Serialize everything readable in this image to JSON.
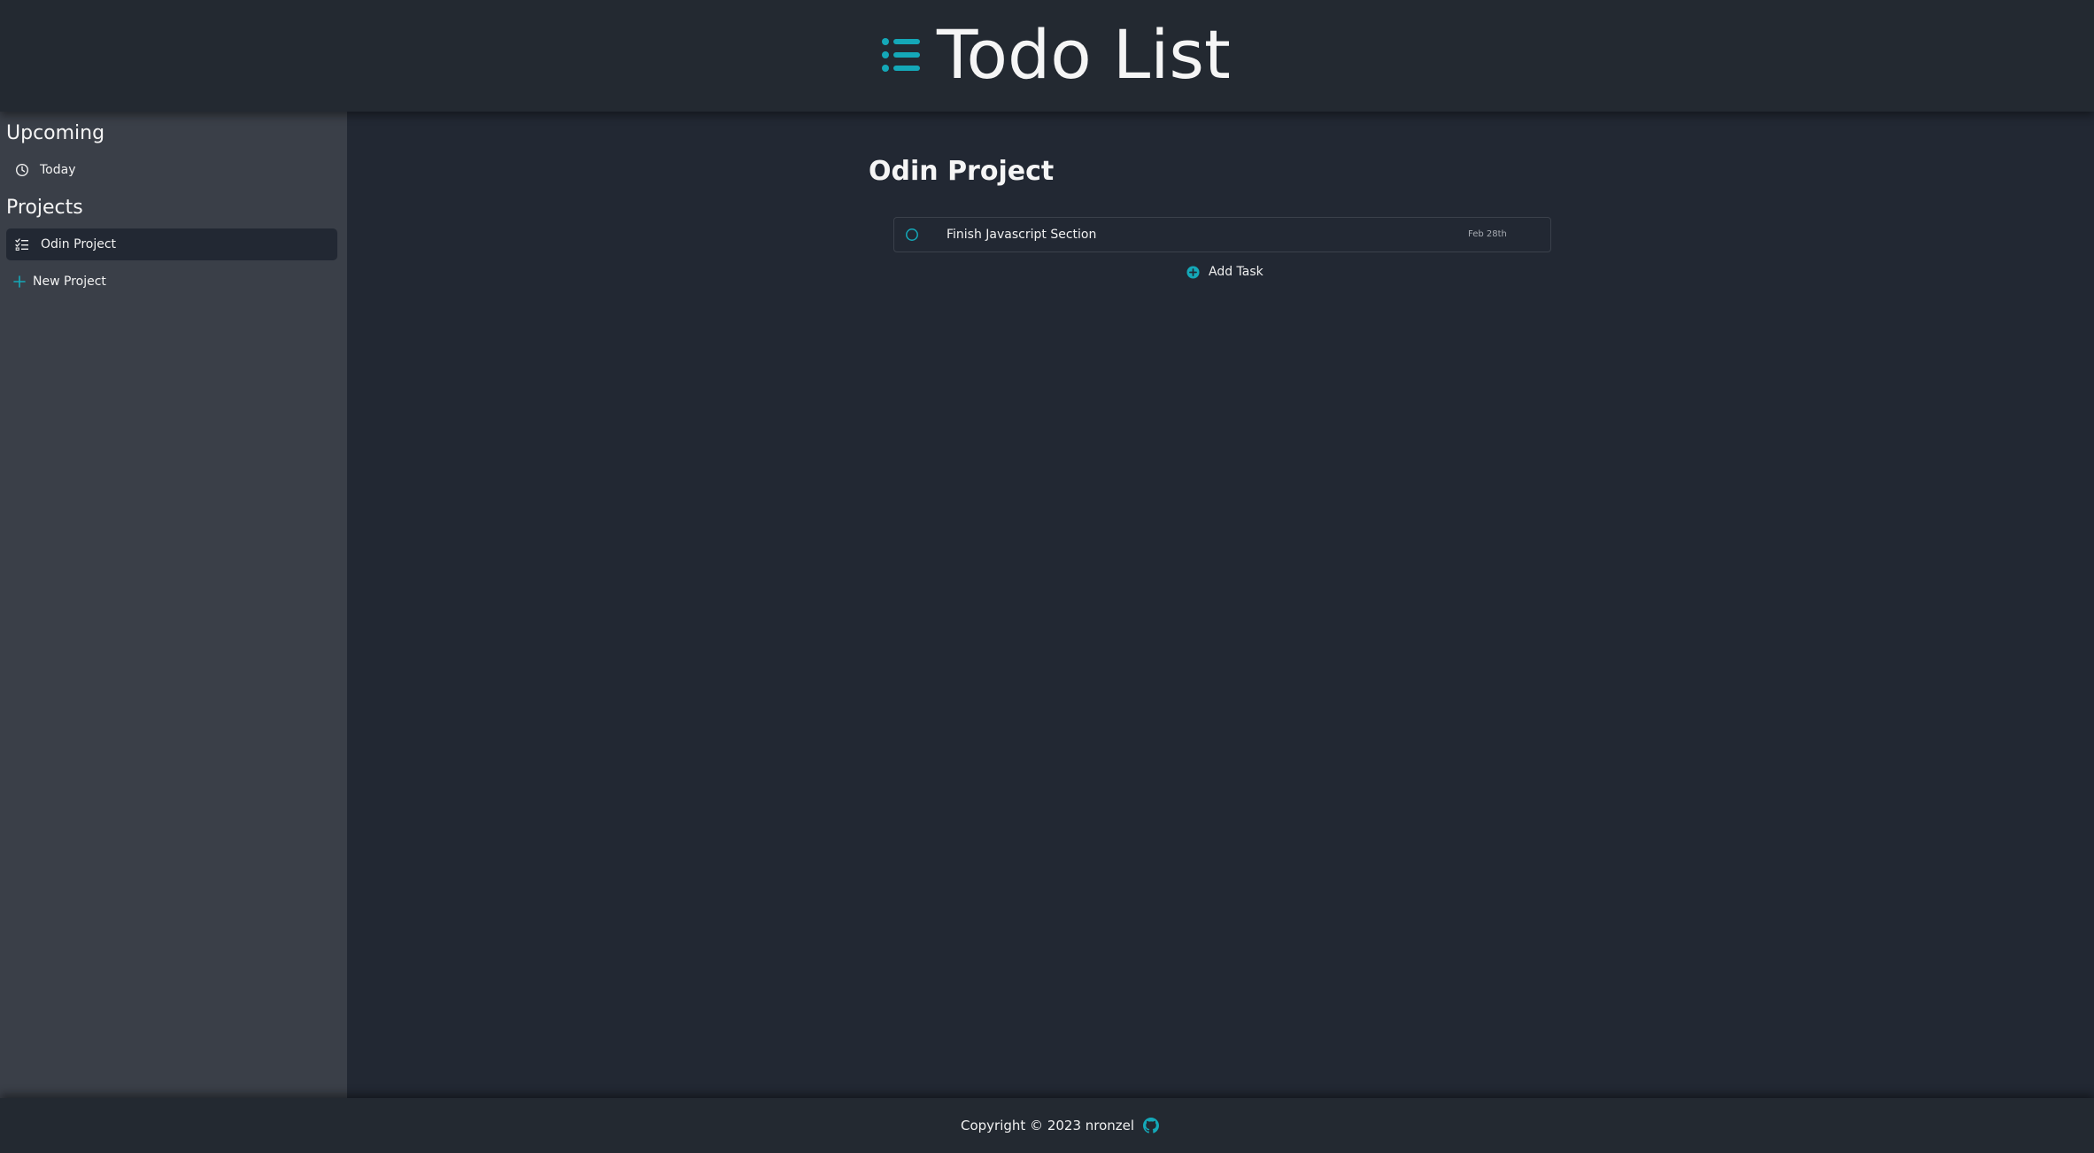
{
  "colors": {
    "accent": "#14a8b8",
    "background": "#222833",
    "header": "#232931",
    "sidebar": "#3a3f48"
  },
  "header": {
    "title": "Todo List",
    "logo_icon": "list-icon"
  },
  "sidebar": {
    "upcoming_heading": "Upcoming",
    "upcoming_items": [
      {
        "label": "Today",
        "icon": "clock-icon"
      }
    ],
    "projects_heading": "Projects",
    "projects": [
      {
        "label": "Odin Project",
        "icon": "checklist-icon",
        "active": true
      }
    ],
    "new_project_label": "New Project"
  },
  "main": {
    "project_title": "Odin Project",
    "tasks": [
      {
        "title": "Finish Javascript Section",
        "due": "Feb 28th"
      }
    ],
    "add_task_label": "Add Task"
  },
  "footer": {
    "copyright": "Copyright © 2023 nronzel",
    "github_icon": "github-icon"
  }
}
